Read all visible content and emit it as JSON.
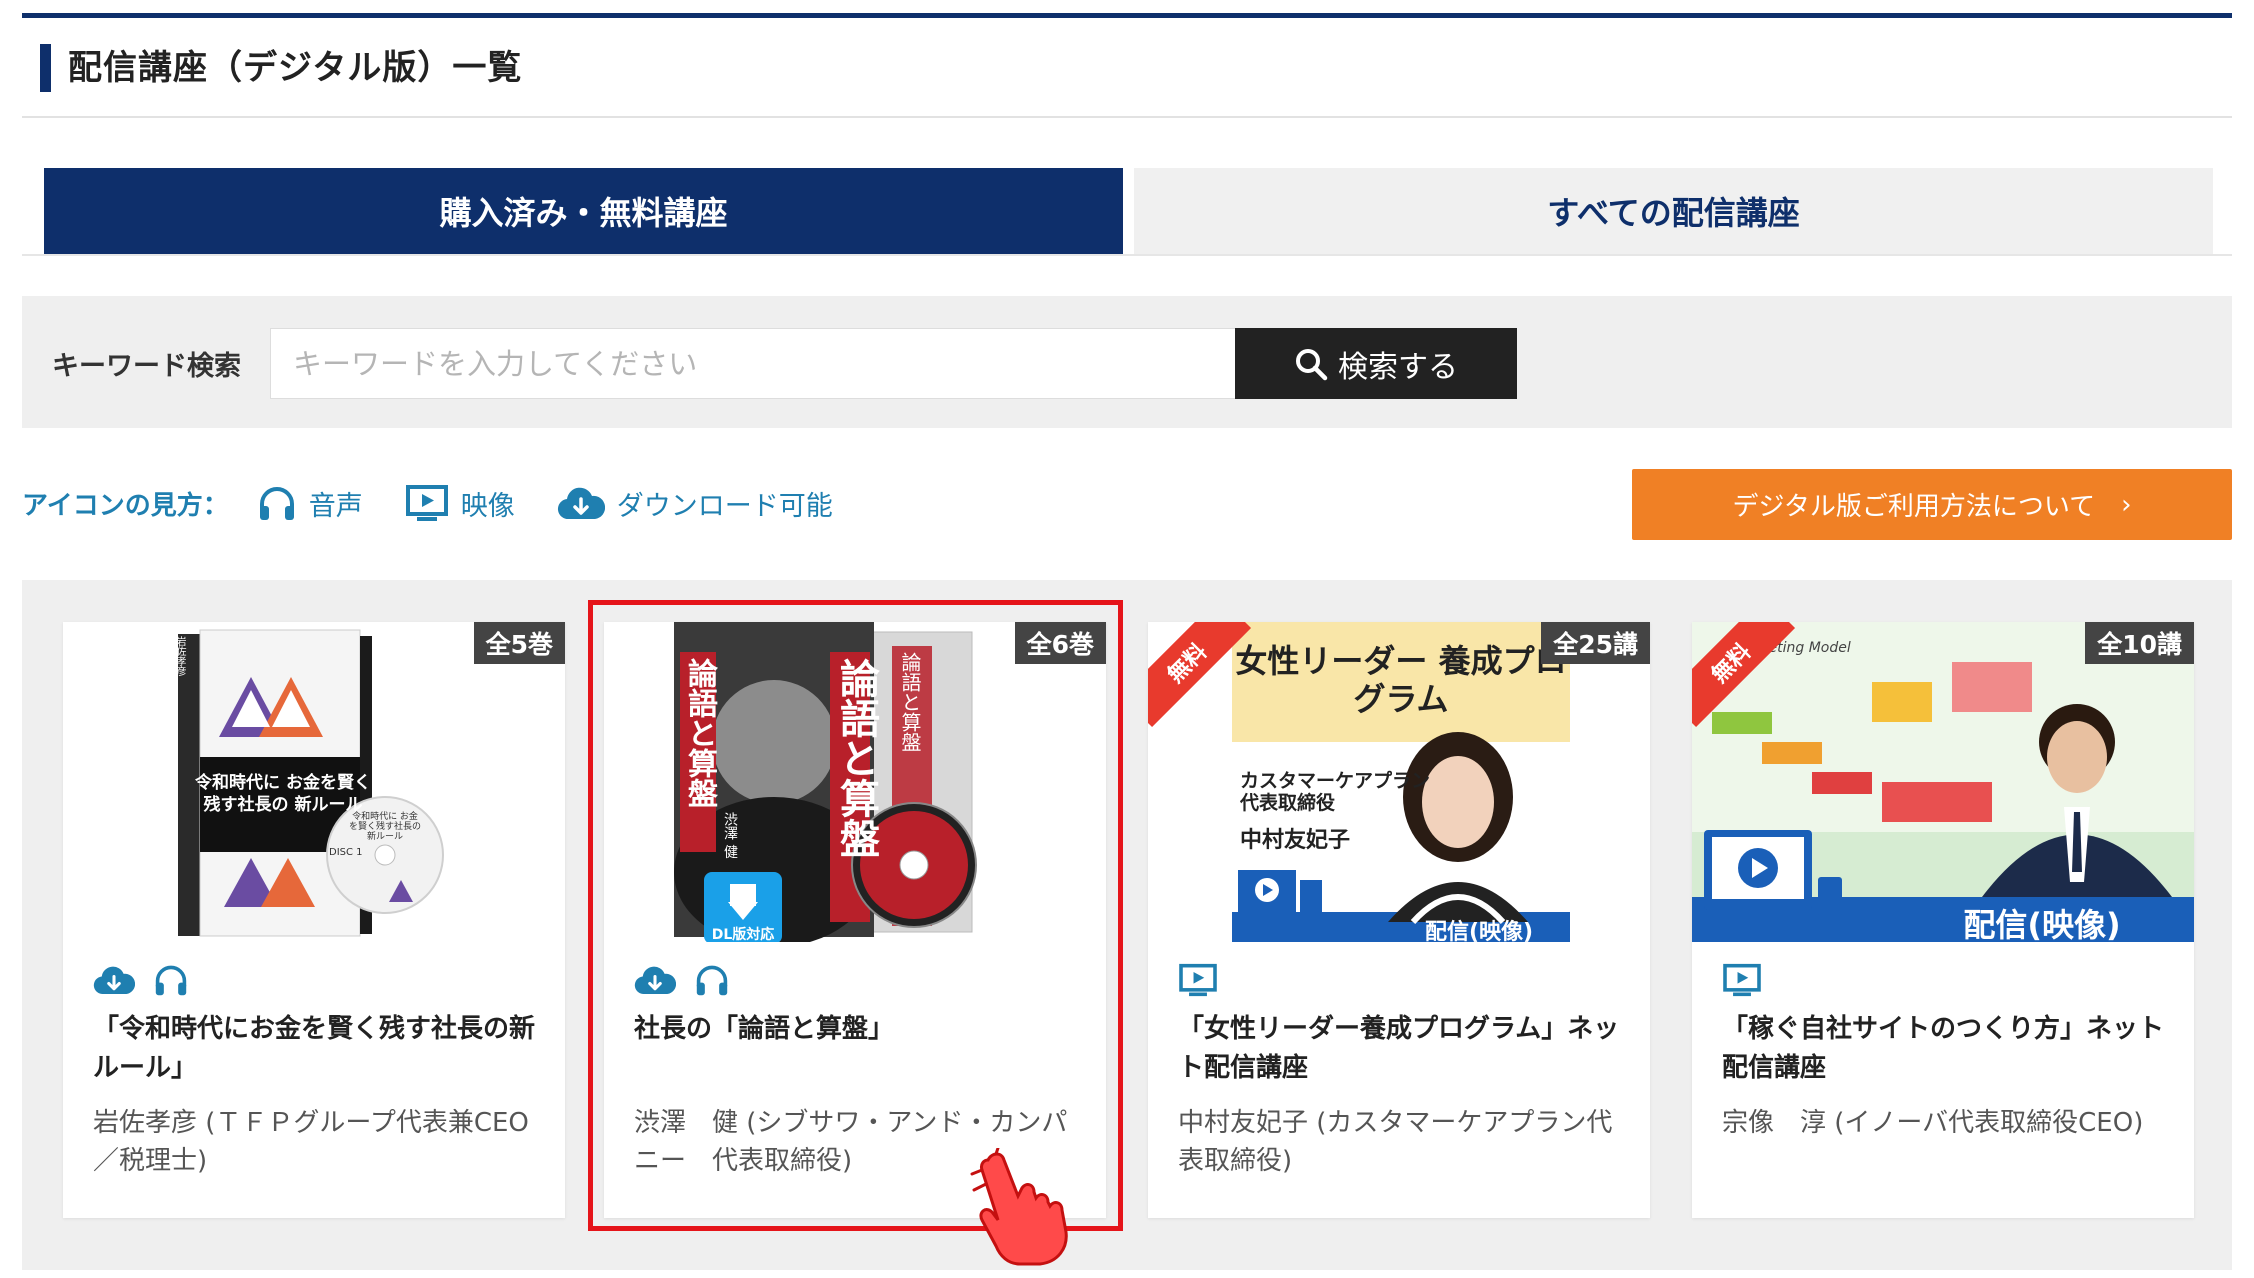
{
  "page": {
    "title": "配信講座（デジタル版）一覧"
  },
  "tabs": [
    {
      "label": "購入済み・無料講座",
      "active": true
    },
    {
      "label": "すべての配信講座",
      "active": false
    }
  ],
  "search": {
    "label": "キーワード検索",
    "placeholder": "キーワードを入力してください",
    "button_label": "検索する"
  },
  "legend": {
    "title": "アイコンの見方：",
    "items": [
      {
        "icon": "headphones-icon",
        "label": "音声"
      },
      {
        "icon": "video-icon",
        "label": "映像"
      },
      {
        "icon": "cloud-download-icon",
        "label": "ダウンロード可能"
      }
    ]
  },
  "guide_button": {
    "label": "デジタル版ご利用方法について",
    "chevron": "›"
  },
  "colors": {
    "navy": "#0e2f6b",
    "orange": "#f08025",
    "link_blue": "#1f7fb0",
    "highlight_red": "#e5141a",
    "free_red": "#e83a2d"
  },
  "courses": [
    {
      "count": "全5巻",
      "free": false,
      "icons": [
        "cloud-download-icon",
        "headphones-icon"
      ],
      "title": "「令和時代にお金を賢く残す社長の新ルール」",
      "author": "岩佐孝彦 (ＴＦＰグループ代表兼CEO／税理士)",
      "cover": {
        "box_title": "令和時代に お金を賢く残す社長の 新ルール",
        "spine": "岩佐孝彦",
        "disc_text": "令和時代に お金を賢く残す社長の 新ルール",
        "disc_label": "DISC 1"
      }
    },
    {
      "count": "全6巻",
      "free": false,
      "icons": [
        "cloud-download-icon",
        "headphones-icon"
      ],
      "title": "社長の「論語と算盤」",
      "author": "渋澤　健 (シブサワ・アンド・カンパニー　代表取締役)",
      "cover": {
        "vertical_title": "論語と算盤",
        "author_vertical": "渋澤 健",
        "dl_badge": "DL版対応"
      }
    },
    {
      "count": "全25講",
      "free": true,
      "free_label": "無料",
      "icons": [
        "video-icon"
      ],
      "title": "「女性リーダー養成プログラム」ネット配信講座",
      "author": "中村友妃子 (カスタマーケアプラン代表取締役)",
      "cover": {
        "headline": "女性リーダー 養成プログラム",
        "company": "カスタマーケアプラン 代表取締役",
        "name": "中村友妃子",
        "banner": "配信(映像)"
      }
    },
    {
      "count": "全10講",
      "free": true,
      "free_label": "無料",
      "icons": [
        "video-icon"
      ],
      "title": "「稼ぐ自社サイトのつくり方」ネット配信講座",
      "author": "宗像　淳 (イノーバ代表取締役CEO)",
      "cover": {
        "slide_title": "Marketing Model",
        "banner": "配信(映像)"
      }
    }
  ]
}
